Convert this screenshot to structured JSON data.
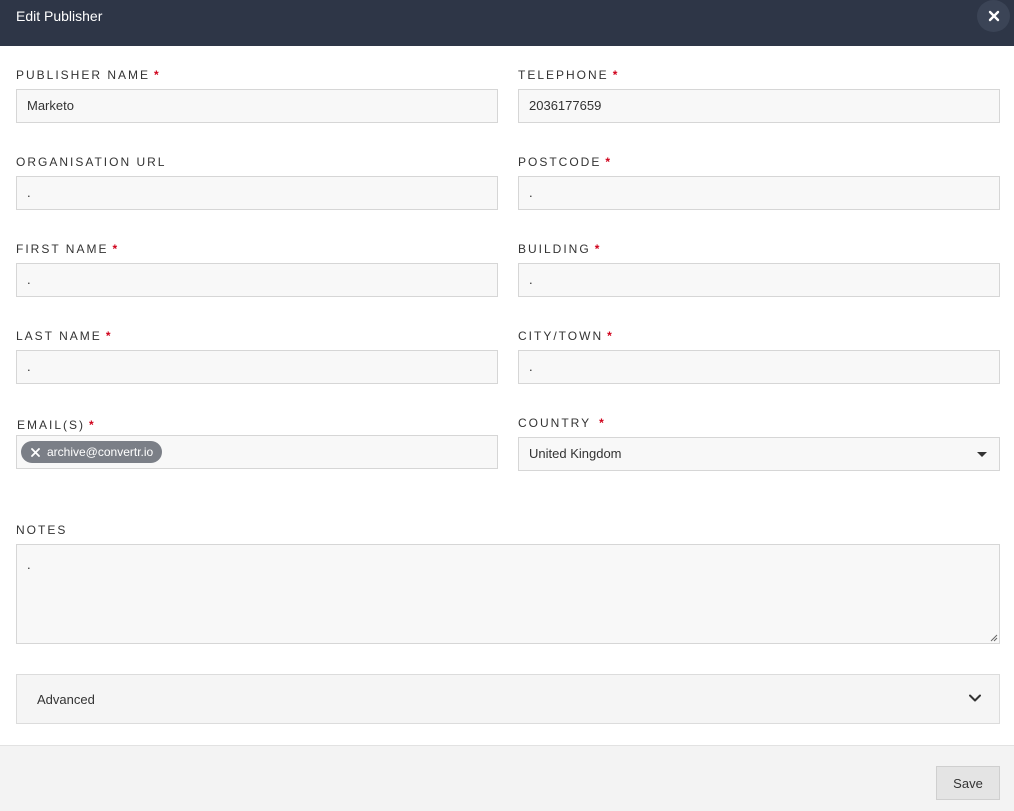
{
  "header": {
    "title": "Edit Publisher"
  },
  "fields": {
    "publisher_name": {
      "label": "PUBLISHER NAME",
      "value": "Marketo"
    },
    "telephone": {
      "label": "TELEPHONE",
      "value": "2036177659"
    },
    "organisation_url": {
      "label": "ORGANISATION URL",
      "value": "."
    },
    "postcode": {
      "label": "POSTCODE",
      "value": "."
    },
    "first_name": {
      "label": "FIRST NAME",
      "value": "."
    },
    "building": {
      "label": "BUILDING",
      "value": "."
    },
    "last_name": {
      "label": "LAST NAME",
      "value": "."
    },
    "city_town": {
      "label": "CITY/TOWN",
      "value": "."
    },
    "emails": {
      "label": "EMAIL(S)",
      "tags": [
        "archive@convertr.io"
      ]
    },
    "country": {
      "label": "COUNTRY",
      "value": "United Kingdom"
    },
    "notes": {
      "label": "NOTES",
      "value": "."
    }
  },
  "required_marker": "*",
  "advanced": {
    "label": "Advanced"
  },
  "footer": {
    "save_label": "Save"
  },
  "colors": {
    "header_bg": "#2e3647",
    "required": "#d0021b",
    "tag_bg": "#7b7f87"
  },
  "icons": {
    "close": "close-icon",
    "tag_remove": "x-icon",
    "select_caret": "caret-down-icon",
    "advanced_toggle": "chevron-down-icon"
  }
}
